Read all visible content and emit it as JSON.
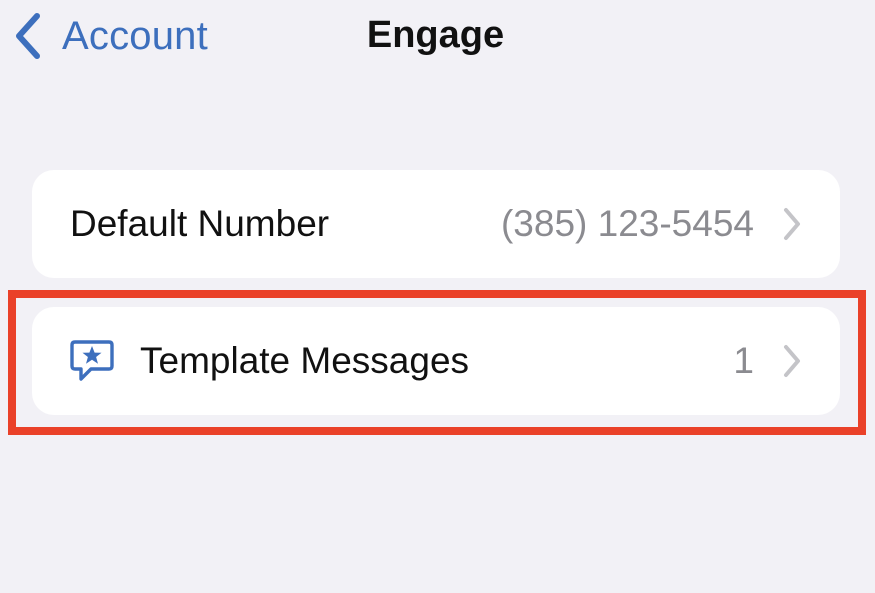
{
  "nav": {
    "back_label": "Account",
    "title": "Engage",
    "back_icon": "chevron-left-icon"
  },
  "rows": {
    "default_number": {
      "label": "Default Number",
      "value": "(385) 123-5454",
      "chevron_icon": "chevron-right-icon"
    },
    "template_messages": {
      "label": "Template Messages",
      "value": "1",
      "icon": "star-message-icon",
      "chevron_icon": "chevron-right-icon"
    }
  },
  "colors": {
    "background": "#f2f1f6",
    "accent": "#3d6fbd",
    "highlight": "#ea4129",
    "secondary_text": "#8b8b90",
    "chevron": "#c4c4c8"
  }
}
